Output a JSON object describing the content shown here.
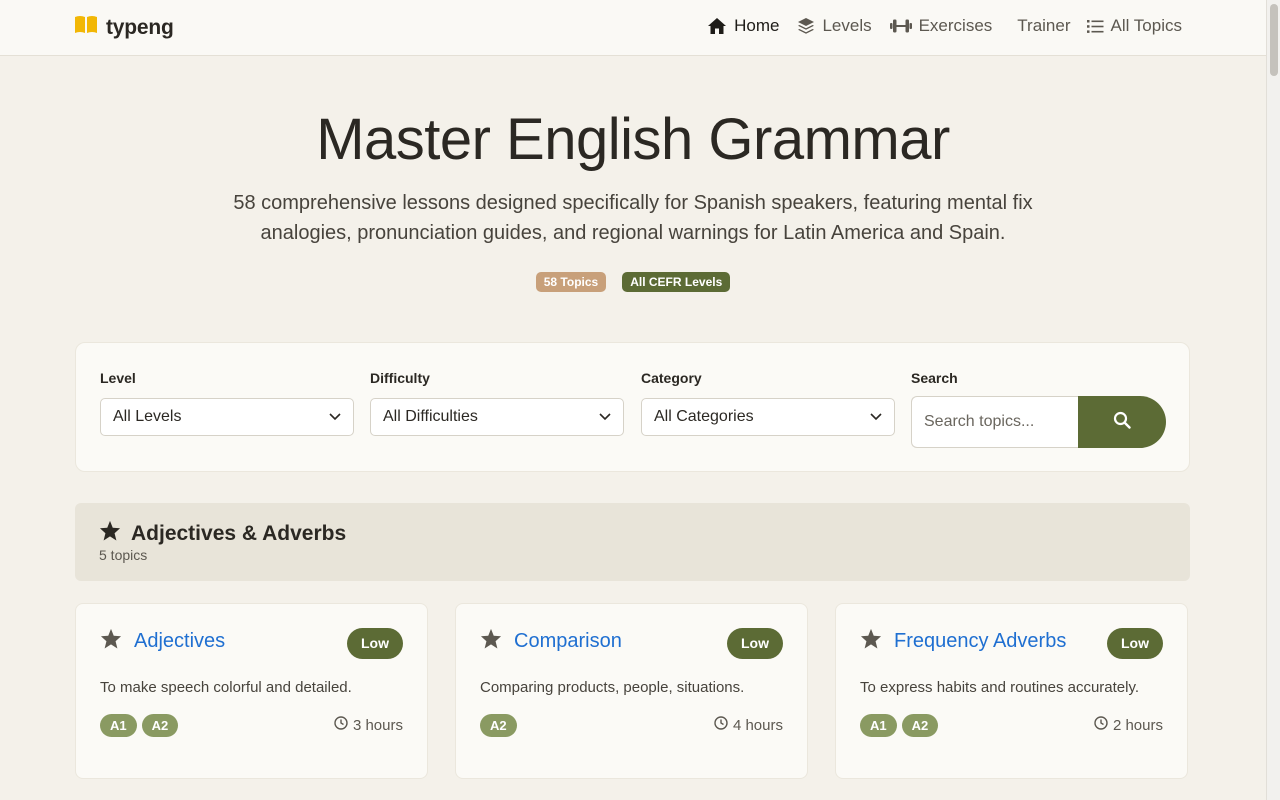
{
  "brand": {
    "name": "typeng",
    "icon": "open-book-icon"
  },
  "nav": {
    "items": [
      {
        "label": "Home",
        "icon": "home-icon",
        "active": true
      },
      {
        "label": "Levels",
        "icon": "layers-icon"
      },
      {
        "label": "Exercises",
        "icon": "dumbbell-icon"
      },
      {
        "label": "Trainer",
        "icon": ""
      },
      {
        "label": "All Topics",
        "icon": "list-icon"
      }
    ]
  },
  "hero": {
    "title": "Master English Grammar",
    "subtitle": "58 comprehensive lessons designed specifically for Spanish speakers, featuring mental fix analogies, pronunciation guides, and regional warnings for Latin America and Spain.",
    "badges": [
      "58 Topics",
      "All CEFR Levels"
    ]
  },
  "filters": {
    "level": {
      "label": "Level",
      "value": "All Levels"
    },
    "difficulty": {
      "label": "Difficulty",
      "value": "All Difficulties"
    },
    "category": {
      "label": "Category",
      "value": "All Categories"
    },
    "search": {
      "label": "Search",
      "placeholder": "Search topics..."
    }
  },
  "category": {
    "title": "Adjectives & Adverbs",
    "count": "5 topics",
    "icon": "star-icon"
  },
  "topics": [
    {
      "title": "Adjectives",
      "difficulty": "Low",
      "description": "To make speech colorful and detailed.",
      "levels": [
        "A1",
        "A2"
      ],
      "duration": "3 hours"
    },
    {
      "title": "Comparison",
      "difficulty": "Low",
      "description": "Comparing products, people, situations.",
      "levels": [
        "A2"
      ],
      "duration": "4 hours"
    },
    {
      "title": "Frequency Adverbs",
      "difficulty": "Low",
      "description": "To express habits and routines accurately.",
      "levels": [
        "A1",
        "A2"
      ],
      "duration": "2 hours"
    }
  ],
  "colors": {
    "background": "#f4f1ea",
    "olive": "#5c6b35",
    "tan": "#c8a07a",
    "link": "#1f6fd1",
    "level_badge": "#8a9a62"
  }
}
